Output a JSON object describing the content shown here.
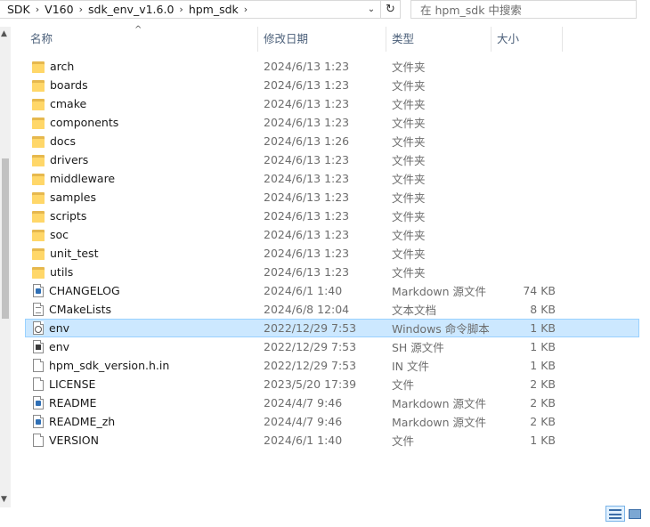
{
  "address": {
    "crumbs": [
      "SDK",
      "V160",
      "sdk_env_v1.6.0",
      "hpm_sdk"
    ],
    "separator": "›",
    "dropdown": "⌄",
    "refresh": "↻"
  },
  "search": {
    "placeholder": "在 hpm_sdk 中搜索"
  },
  "columns": {
    "name": "名称",
    "date": "修改日期",
    "type": "类型",
    "size": "大小",
    "sort_indicator": "^"
  },
  "files": [
    {
      "icon": "folder-icon",
      "name": "arch",
      "date": "2024/6/13 1:23",
      "type": "文件夹",
      "size": ""
    },
    {
      "icon": "folder-icon",
      "name": "boards",
      "date": "2024/6/13 1:23",
      "type": "文件夹",
      "size": ""
    },
    {
      "icon": "folder-icon",
      "name": "cmake",
      "date": "2024/6/13 1:23",
      "type": "文件夹",
      "size": ""
    },
    {
      "icon": "folder-icon",
      "name": "components",
      "date": "2024/6/13 1:23",
      "type": "文件夹",
      "size": ""
    },
    {
      "icon": "folder-icon",
      "name": "docs",
      "date": "2024/6/13 1:26",
      "type": "文件夹",
      "size": ""
    },
    {
      "icon": "folder-icon",
      "name": "drivers",
      "date": "2024/6/13 1:23",
      "type": "文件夹",
      "size": ""
    },
    {
      "icon": "folder-icon",
      "name": "middleware",
      "date": "2024/6/13 1:23",
      "type": "文件夹",
      "size": ""
    },
    {
      "icon": "folder-icon",
      "name": "samples",
      "date": "2024/6/13 1:23",
      "type": "文件夹",
      "size": ""
    },
    {
      "icon": "folder-icon",
      "name": "scripts",
      "date": "2024/6/13 1:23",
      "type": "文件夹",
      "size": ""
    },
    {
      "icon": "folder-icon",
      "name": "soc",
      "date": "2024/6/13 1:23",
      "type": "文件夹",
      "size": ""
    },
    {
      "icon": "folder-icon",
      "name": "unit_test",
      "date": "2024/6/13 1:23",
      "type": "文件夹",
      "size": ""
    },
    {
      "icon": "folder-icon",
      "name": "utils",
      "date": "2024/6/13 1:23",
      "type": "文件夹",
      "size": ""
    },
    {
      "icon": "markdown-file-icon",
      "name": "CHANGELOG",
      "date": "2024/6/1 1:40",
      "type": "Markdown 源文件",
      "size": "74 KB"
    },
    {
      "icon": "text-file-icon",
      "name": "CMakeLists",
      "date": "2024/6/8 12:04",
      "type": "文本文档",
      "size": "8 KB"
    },
    {
      "icon": "batch-file-icon",
      "name": "env",
      "date": "2022/12/29 7:53",
      "type": "Windows 命令脚本",
      "size": "1 KB",
      "selected": true
    },
    {
      "icon": "shell-file-icon",
      "name": "env",
      "date": "2022/12/29 7:53",
      "type": "SH 源文件",
      "size": "1 KB"
    },
    {
      "icon": "generic-file-icon",
      "name": "hpm_sdk_version.h.in",
      "date": "2022/12/29 7:53",
      "type": "IN 文件",
      "size": "1 KB"
    },
    {
      "icon": "generic-file-icon",
      "name": "LICENSE",
      "date": "2023/5/20 17:39",
      "type": "文件",
      "size": "2 KB"
    },
    {
      "icon": "markdown-file-icon",
      "name": "README",
      "date": "2024/4/7 9:46",
      "type": "Markdown 源文件",
      "size": "2 KB"
    },
    {
      "icon": "markdown-file-icon",
      "name": "README_zh",
      "date": "2024/4/7 9:46",
      "type": "Markdown 源文件",
      "size": "2 KB"
    },
    {
      "icon": "generic-file-icon",
      "name": "VERSION",
      "date": "2024/6/1 1:40",
      "type": "文件",
      "size": "1 KB"
    }
  ],
  "colors": {
    "selection": "#cce8ff",
    "folder": "#ffd769",
    "header_text": "#4c607a"
  }
}
